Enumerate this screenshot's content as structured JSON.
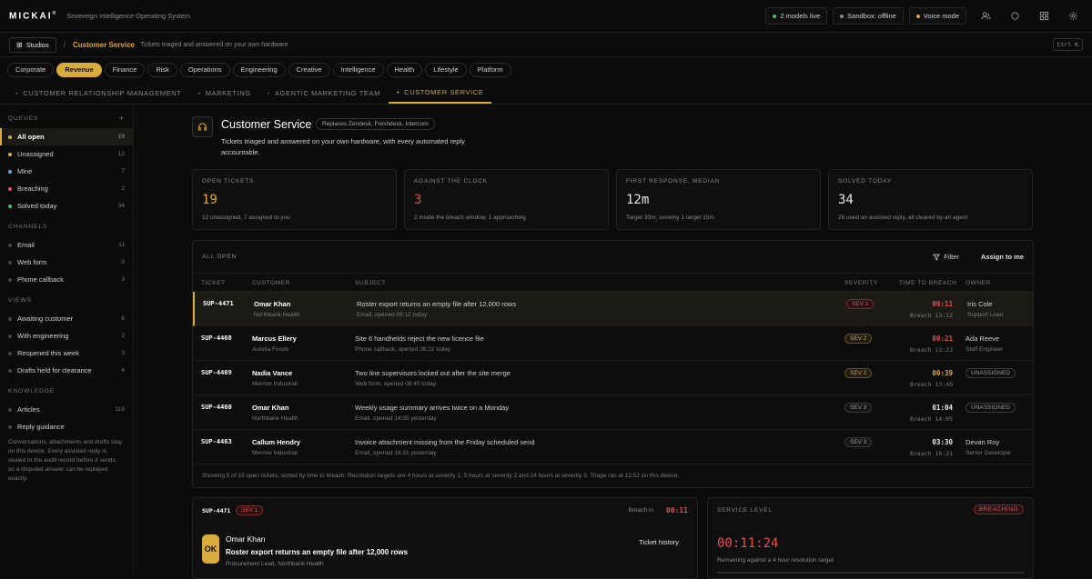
{
  "topbar": {
    "logo": "MICKAI",
    "logo_mark": "®",
    "tagline": "Sovereign Intelligence Operating System",
    "pills": [
      {
        "label": "2 models live",
        "dot": "#3fc46a"
      },
      {
        "label": "Sandbox: offline",
        "dot": "#888888"
      },
      {
        "label": "Voice mode",
        "dot": "#e0a43a"
      }
    ]
  },
  "breadcrumb": {
    "studios": "Studios",
    "current": "Customer Service",
    "subtitle": "Tickets triaged and answered on your own hardware",
    "shortcut": "Ctrl K"
  },
  "categories": [
    "Corporate",
    "Revenue",
    "Finance",
    "Risk",
    "Operations",
    "Engineering",
    "Creative",
    "Intelligence",
    "Health",
    "Lifestyle",
    "Platform"
  ],
  "subtabs": [
    "CUSTOMER RELATIONSHIP MANAGEMENT",
    "MARKETING",
    "AGENTIC MARKETING TEAM",
    "CUSTOMER SERVICE"
  ],
  "sidebar": {
    "queues_label": "QUEUES",
    "queues_add": "+",
    "queues": [
      {
        "label": "All open",
        "count": "19",
        "dot": "#d8ab3a"
      },
      {
        "label": "Unassigned",
        "count": "12",
        "dot": "#d8ab3a"
      },
      {
        "label": "Mine",
        "count": "7",
        "dot": "#6aa6e0"
      },
      {
        "label": "Breaching",
        "count": "2",
        "dot": "#e05252"
      },
      {
        "label": "Solved today",
        "count": "34",
        "dot": "#3fc46a"
      }
    ],
    "channels_label": "CHANNELS",
    "channels": [
      {
        "label": "Email",
        "count": "11"
      },
      {
        "label": "Web form",
        "count": "5"
      },
      {
        "label": "Phone callback",
        "count": "3"
      }
    ],
    "views_label": "VIEWS",
    "views": [
      {
        "label": "Awaiting customer",
        "count": "6"
      },
      {
        "label": "With engineering",
        "count": "2"
      },
      {
        "label": "Reopened this week",
        "count": "3"
      },
      {
        "label": "Drafts held for clearance",
        "count": "4"
      }
    ],
    "knowledge_label": "KNOWLEDGE",
    "knowledge": [
      {
        "label": "Articles",
        "count": "118"
      },
      {
        "label": "Reply guidance",
        "count": ""
      }
    ],
    "note": "Conversations, attachments and drafts stay on this device. Every assisted reply is sealed to the audit record before it sends, so a disputed answer can be replayed exactly."
  },
  "header": {
    "title": "Customer Service",
    "tag": "Replaces Zendesk, Freshdesk, Intercom",
    "description": "Tickets triaged and answered on your own hardware, with every automated reply accountable."
  },
  "stats": [
    {
      "label": "OPEN TICKETS",
      "value": "19",
      "sub": "12 unassigned, 7 assigned to you",
      "color": "#e0a43a"
    },
    {
      "label": "AGAINST THE CLOCK",
      "value": "3",
      "sub": "2 inside the breach window, 1 approaching",
      "color": "#e05252"
    },
    {
      "label": "FIRST RESPONSE, MEDIAN",
      "value": "12m",
      "sub": "Target 30m, severity 1 target 15m",
      "color": "#e8e8e8"
    },
    {
      "label": "SOLVED TODAY",
      "value": "34",
      "sub": "26 used an assisted reply, all cleared by an agent",
      "color": "#e8e8e8"
    }
  ],
  "table": {
    "title": "ALL OPEN",
    "filter": "Filter",
    "assign": "Assign to me",
    "columns": [
      "TICKET",
      "CUSTOMER",
      "SUBJECT",
      "SEVERITY",
      "TIME TO BREACH",
      "OWNER"
    ],
    "rows": [
      {
        "id": "SUP-4471",
        "name": "Omar Khan",
        "org": "Northbank Health",
        "subject": "Roster export returns an empty file after 12,000 rows",
        "meta": "Email, opened 09:12 today",
        "sev": "SEV 1",
        "time": "00:11",
        "breach": "Breach 13:12",
        "owner": "Iris Cole",
        "role": "Support Lead"
      },
      {
        "id": "SUP-4468",
        "name": "Marcus Ellery",
        "org": "Aurelia Foods",
        "subject": "Site 6 handhelds reject the new licence file",
        "meta": "Phone callback, opened 08:22 today",
        "sev": "SEV 2",
        "time": "00:21",
        "breach": "Breach 13:22",
        "owner": "Ada Reeve",
        "role": "Staff Engineer"
      },
      {
        "id": "SUP-4469",
        "name": "Nadia Vance",
        "org": "Merrow Industrial",
        "subject": "Two line supervisors locked out after the site merge",
        "meta": "Web form, opened 08:40 today",
        "sev": "SEV 2",
        "time": "00:39",
        "breach": "Breach 13:40",
        "owner": "UNASSIGNED",
        "role": ""
      },
      {
        "id": "SUP-4460",
        "name": "Omar Khan",
        "org": "Northbank Health",
        "subject": "Weekly usage summary arrives twice on a Monday",
        "meta": "Email, opened 14:05 yesterday",
        "sev": "SEV 3",
        "time": "01:04",
        "breach": "Breach 14:05",
        "owner": "UNASSIGNED",
        "role": ""
      },
      {
        "id": "SUP-4463",
        "name": "Callum Hendry",
        "org": "Merrow Industrial",
        "subject": "Invoice attachment missing from the Friday scheduled send",
        "meta": "Email, opened 16:31 yesterday",
        "sev": "SEV 3",
        "time": "03:30",
        "breach": "Breach 16:31",
        "owner": "Devan Roy",
        "role": "Senior Developer"
      }
    ],
    "footer": "Showing 5 of 19 open tickets, sorted by time to breach. Resolution targets are 4 hours at severity 1, 5 hours at severity 2 and 24 hours at severity 3. Triage ran at 12:52 on this device."
  },
  "detail": {
    "id": "SUP-4471",
    "sev": "SEV 1",
    "breach_label": "Breach in",
    "breach_time": "00:11",
    "avatar": "OK",
    "name": "Omar Khan",
    "subject": "Roster export returns an empty file after 12,000 rows",
    "role": "Procurement Lead, Northbank Health",
    "history": "Ticket history"
  },
  "service": {
    "title": "SERVICE LEVEL",
    "badge": "BREACHING",
    "timer": "00:11:24",
    "sub": "Remaining against a 4 hour resolution target"
  }
}
